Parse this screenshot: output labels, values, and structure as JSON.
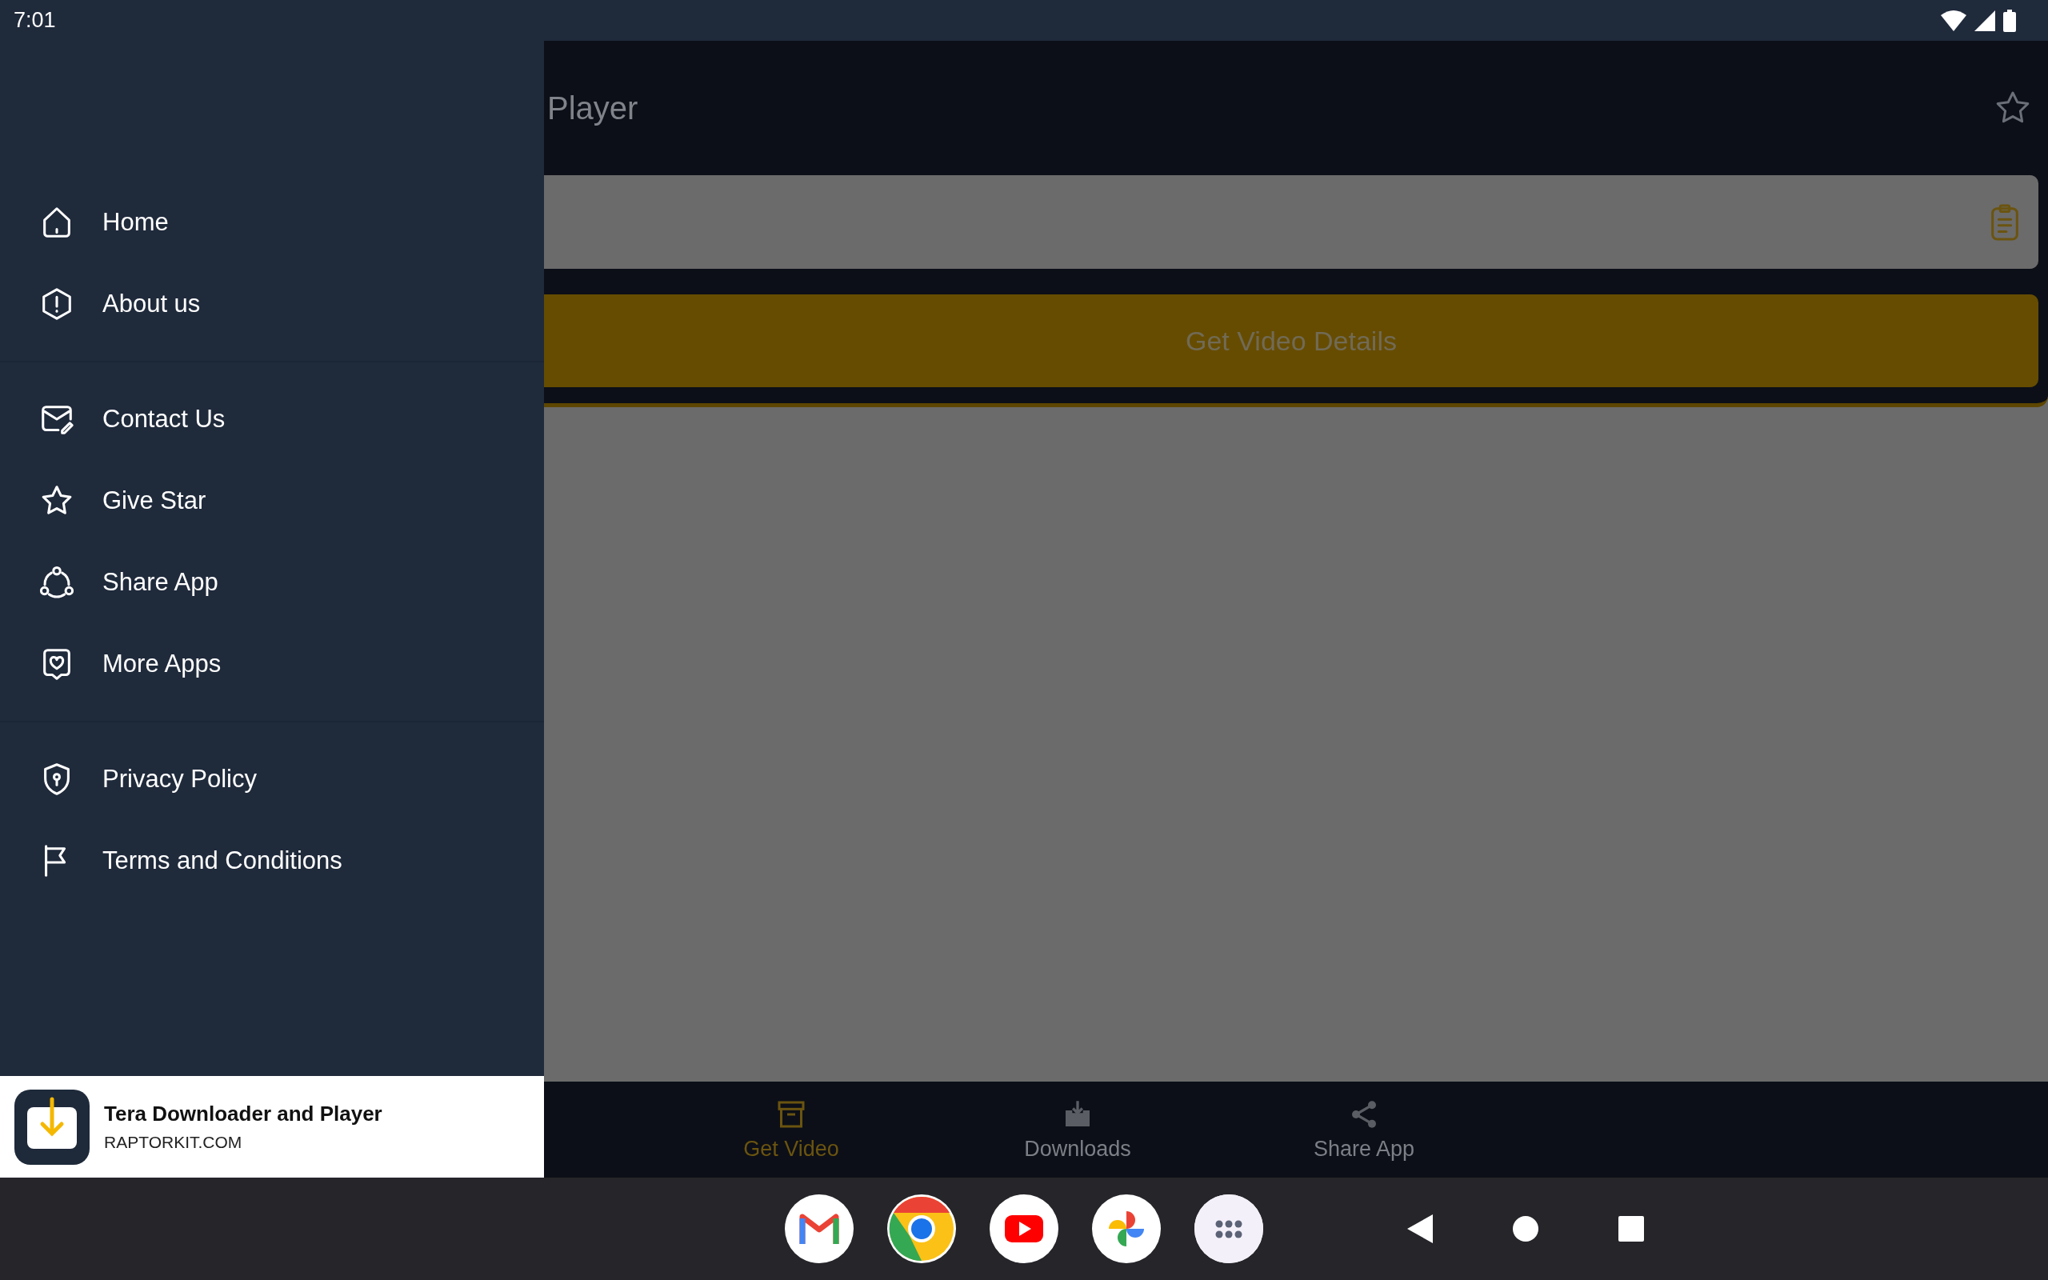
{
  "status_bar": {
    "time": "7:01"
  },
  "drawer": {
    "groups": [
      {
        "items": [
          {
            "label": "Home"
          },
          {
            "label": "About us"
          }
        ]
      },
      {
        "items": [
          {
            "label": "Contact Us"
          },
          {
            "label": "Give Star"
          },
          {
            "label": "Share App"
          },
          {
            "label": "More Apps"
          }
        ]
      },
      {
        "items": [
          {
            "label": "Privacy Policy"
          },
          {
            "label": "Terms and Conditions"
          }
        ]
      }
    ]
  },
  "ad_banner": {
    "title": "Tera Downloader and Player",
    "url": "RAPTORKIT.COM"
  },
  "app_bar": {
    "title": "Player"
  },
  "get_details_button": {
    "label": "Get Video Details"
  },
  "bottom_nav": [
    {
      "label": "Get Video",
      "selected": true
    },
    {
      "label": "Downloads",
      "selected": false
    },
    {
      "label": "Share App",
      "selected": false
    }
  ]
}
